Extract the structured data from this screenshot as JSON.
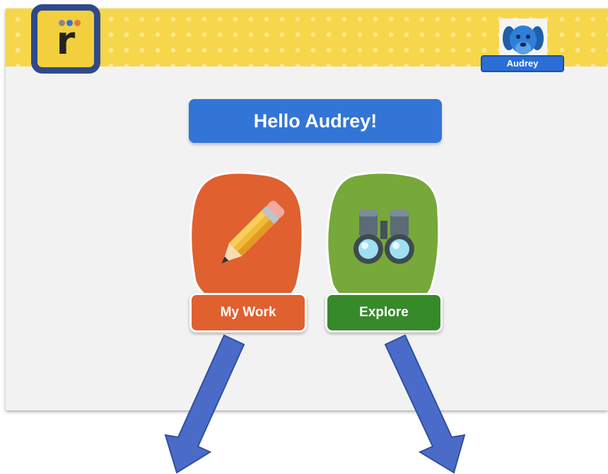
{
  "app": {
    "logo_letter": "r",
    "logo_dot_colors": [
      "#8a8a8a",
      "#3d6fd0",
      "#e07a3a"
    ]
  },
  "profile": {
    "name": "Audrey",
    "avatar": "blue-dog-icon"
  },
  "greeting": "Hello Audrey!",
  "tiles": [
    {
      "label": "My Work",
      "icon": "pencil-icon",
      "color": "#e06030",
      "label_color": "#e06030"
    },
    {
      "label": "Explore",
      "icon": "binoculars-icon",
      "color": "#76a83a",
      "label_color": "#368a2a"
    }
  ],
  "annotations": {
    "arrow_color": "#4a6cc8",
    "arrows": [
      "pointer-arrow-my-work",
      "pointer-arrow-explore"
    ]
  },
  "colors": {
    "header_yellow": "#f6d64b",
    "logo_border": "#2f4a8a",
    "banner_blue": "#3375d6"
  }
}
